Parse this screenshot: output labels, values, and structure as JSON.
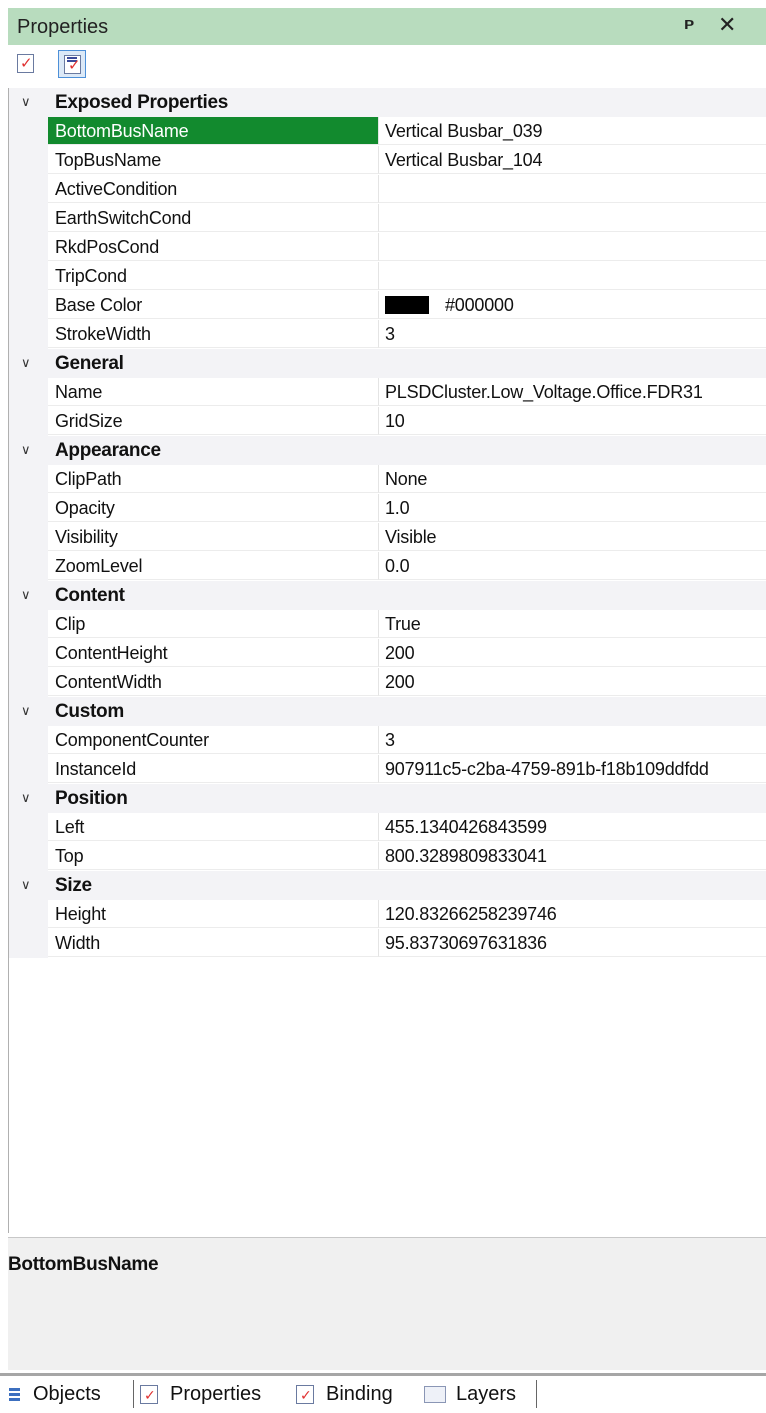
{
  "window": {
    "title": "Properties",
    "pin_glyph": "ᴩ",
    "close_glyph": "✕"
  },
  "toolbar": {
    "buttons": [
      {
        "icon": "categorized-view-icon",
        "selected": false
      },
      {
        "icon": "exposed-view-icon",
        "selected": true
      }
    ]
  },
  "categories": [
    {
      "label": "Exposed Properties",
      "properties": [
        {
          "name": "BottomBusName",
          "value": "Vertical Busbar_039",
          "selected": true
        },
        {
          "name": "TopBusName",
          "value": "Vertical Busbar_104"
        },
        {
          "name": "ActiveCondition",
          "value": ""
        },
        {
          "name": "EarthSwitchCond",
          "value": ""
        },
        {
          "name": "RkdPosCond",
          "value": ""
        },
        {
          "name": "TripCond",
          "value": ""
        },
        {
          "name": "Base Color",
          "value": "#000000",
          "color": "#000000"
        },
        {
          "name": "StrokeWidth",
          "value": "3"
        }
      ]
    },
    {
      "label": "General",
      "properties": [
        {
          "name": "Name",
          "value": "PLSDCluster.Low_Voltage.Office.FDR31"
        },
        {
          "name": "GridSize",
          "value": "10"
        }
      ]
    },
    {
      "label": "Appearance",
      "properties": [
        {
          "name": "ClipPath",
          "value": "None"
        },
        {
          "name": "Opacity",
          "value": "1.0"
        },
        {
          "name": "Visibility",
          "value": "Visible"
        },
        {
          "name": "ZoomLevel",
          "value": "0.0"
        }
      ]
    },
    {
      "label": "Content",
      "properties": [
        {
          "name": "Clip",
          "value": "True"
        },
        {
          "name": "ContentHeight",
          "value": "200"
        },
        {
          "name": "ContentWidth",
          "value": "200"
        }
      ]
    },
    {
      "label": "Custom",
      "properties": [
        {
          "name": "ComponentCounter",
          "value": "3"
        },
        {
          "name": "InstanceId",
          "value": "907911c5-c2ba-4759-891b-f18b109ddfdd"
        }
      ]
    },
    {
      "label": "Position",
      "properties": [
        {
          "name": "Left",
          "value": "455.1340426843599"
        },
        {
          "name": "Top",
          "value": "800.3289809833041"
        }
      ]
    },
    {
      "label": "Size",
      "properties": [
        {
          "name": "Height",
          "value": "120.83266258239746"
        },
        {
          "name": "Width",
          "value": "95.83730697631836"
        }
      ]
    }
  ],
  "help": {
    "title": "BottomBusName"
  },
  "tabs": [
    {
      "label": "Objects",
      "icon": "objects-icon"
    },
    {
      "label": "Properties",
      "icon": "properties-icon"
    },
    {
      "label": "Binding",
      "icon": "binding-icon"
    },
    {
      "label": "Layers",
      "icon": "layers-icon"
    }
  ],
  "colors": {
    "title_bar": "#b8dcbe",
    "selected_row": "#128a2e",
    "category_bg": "#f3f3f6",
    "help_bg": "#f0f0f0"
  }
}
